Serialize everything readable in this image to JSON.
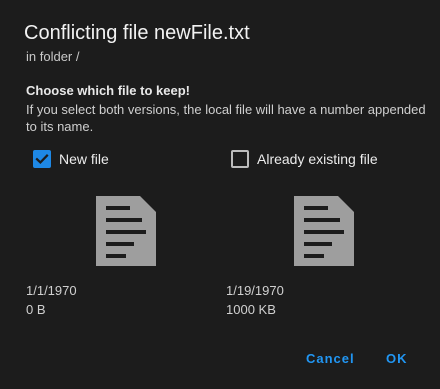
{
  "dialog": {
    "title": "Conflicting file newFile.txt",
    "subtitle": "in folder /",
    "choose_label": "Choose which file to keep!",
    "explanation": "If you select both versions, the local file will have a number appended to its name."
  },
  "options": {
    "new_file": {
      "label": "New file",
      "checked": true,
      "date": "1/1/1970",
      "size": "0 B",
      "icon": "document-icon"
    },
    "existing_file": {
      "label": "Already existing file",
      "checked": false,
      "date": "1/19/1970",
      "size": "1000 KB",
      "icon": "document-icon"
    }
  },
  "actions": {
    "cancel_label": "Cancel",
    "ok_label": "OK"
  },
  "colors": {
    "background": "#1c1c1c",
    "accent": "#2196f3",
    "checkbox_checked": "#1e88e5",
    "file_icon": "#9e9e9e"
  }
}
